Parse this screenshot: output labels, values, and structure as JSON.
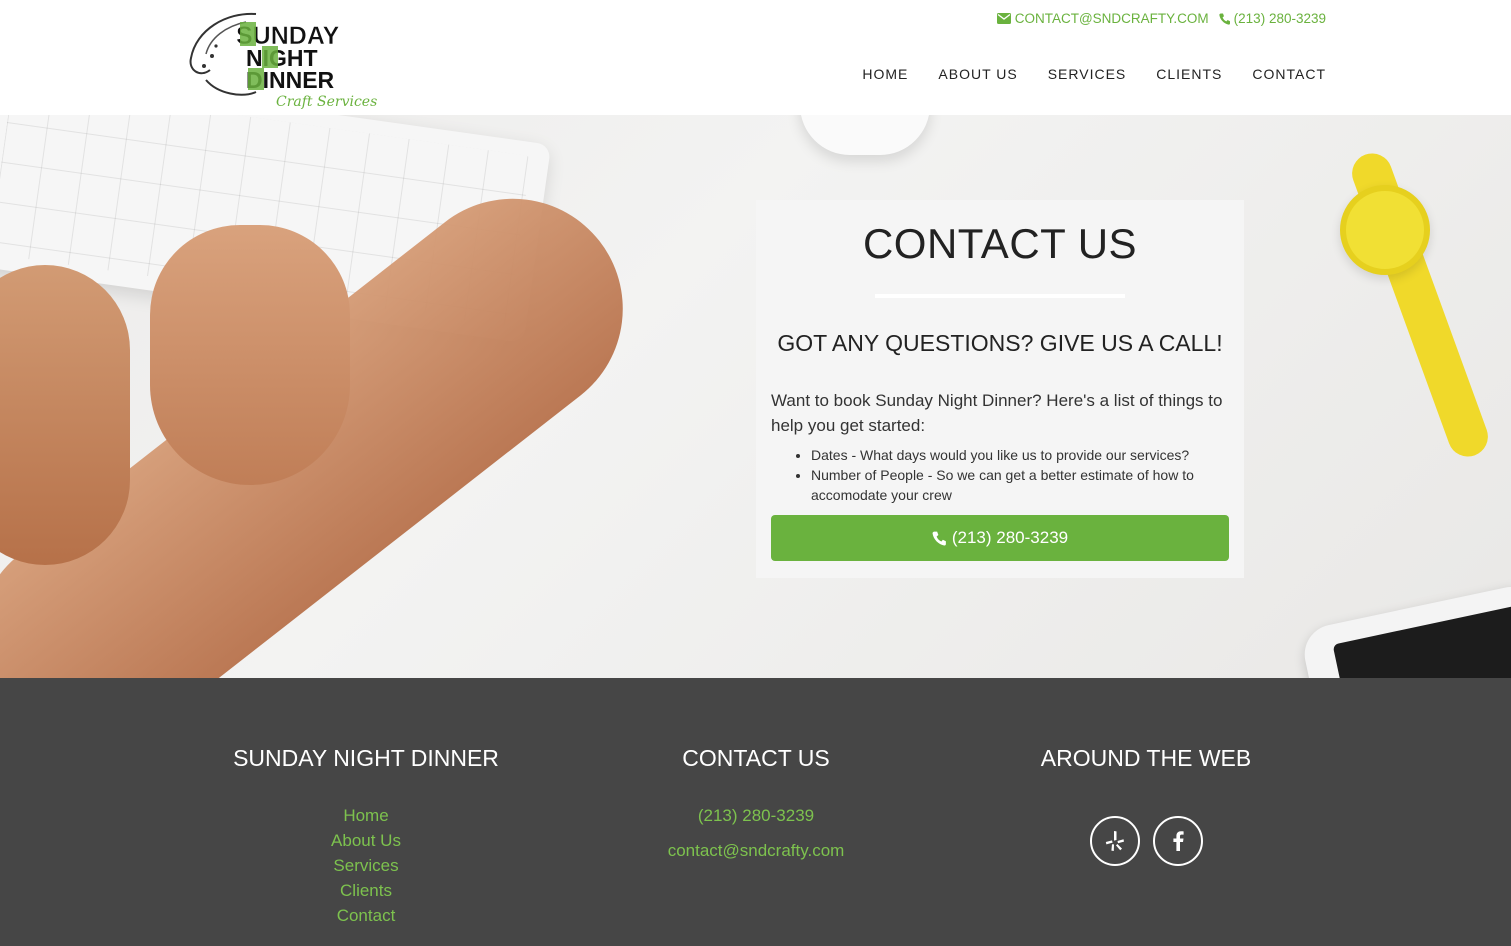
{
  "brand": {
    "logo_words": [
      "SUNDAY",
      "NIGHT",
      "DINNER"
    ],
    "logo_tagline": "Craft Services",
    "accent_color": "#6ab23e"
  },
  "topbar": {
    "email": "CONTACT@SNDCRAFTY.COM",
    "phone": "(213) 280-3239",
    "email_icon": "envelope-icon",
    "phone_icon": "phone-icon"
  },
  "nav": {
    "items": [
      "HOME",
      "ABOUT US",
      "SERVICES",
      "CLIENTS",
      "CONTACT"
    ]
  },
  "hero": {
    "title": "CONTACT US",
    "subtitle": "GOT ANY QUESTIONS? GIVE US A CALL!",
    "intro": "Want to book Sunday Night Dinner? Here's a list of things to help you get started:",
    "bullets": [
      "Dates - What days would you like us to provide our services?",
      "Number of People - So we can get a better estimate of how to accomodate your crew"
    ],
    "call_button": "(213) 280-3239"
  },
  "footer": {
    "col1": {
      "heading": "SUNDAY NIGHT DINNER",
      "links": [
        "Home",
        "About Us",
        "Services",
        "Clients",
        "Contact"
      ]
    },
    "col2": {
      "heading": "CONTACT US",
      "phone": "(213) 280-3239",
      "email": "contact@sndcrafty.com"
    },
    "col3": {
      "heading": "AROUND THE WEB",
      "icons": [
        "yelp-icon",
        "facebook-icon"
      ]
    },
    "link_color": "#7dc24e",
    "background": "#464646"
  }
}
